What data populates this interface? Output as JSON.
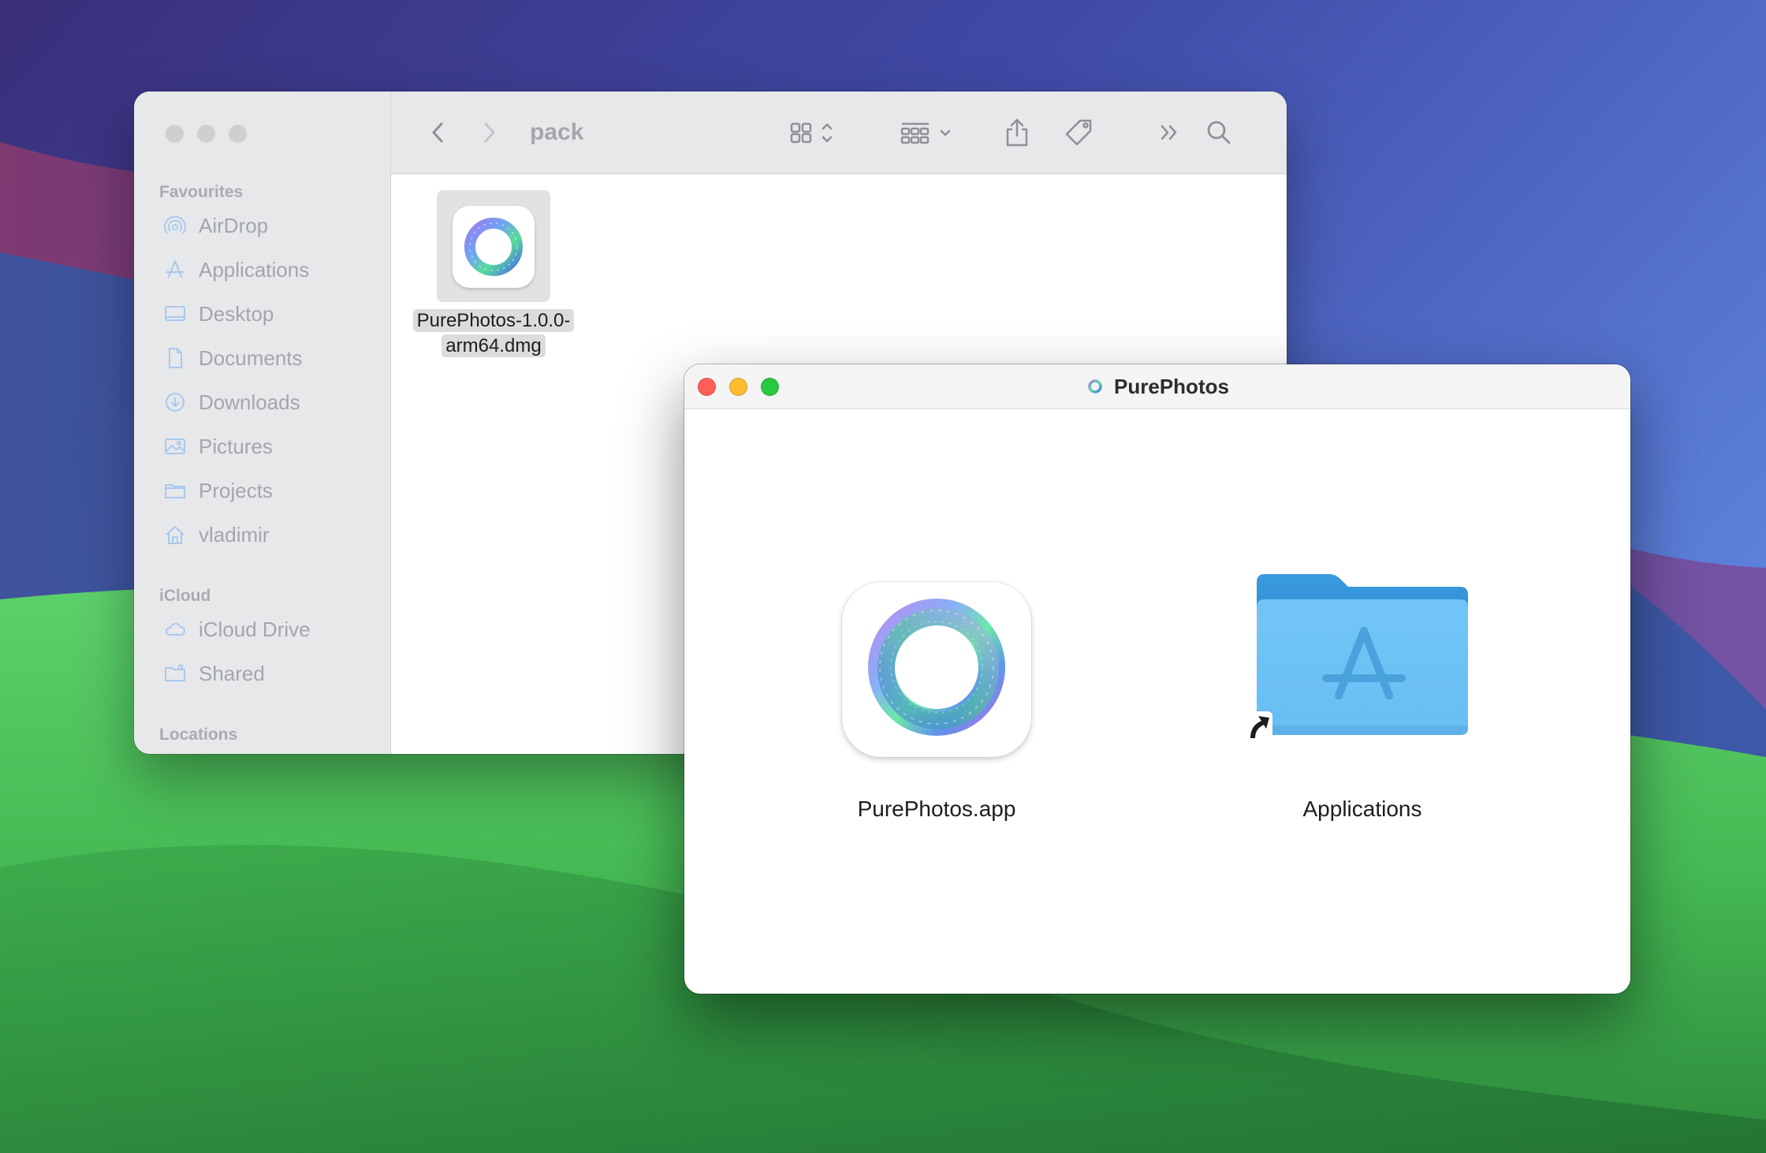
{
  "colors": {
    "traffic_red": "#fe5f57",
    "traffic_yellow": "#febc2e",
    "traffic_green": "#28c840",
    "folder_blue": "#6fc3f5"
  },
  "finder": {
    "title": "pack",
    "sidebar": {
      "favourites_heading": "Favourites",
      "favourites": [
        {
          "label": "AirDrop",
          "icon": "airdrop-icon"
        },
        {
          "label": "Applications",
          "icon": "applications-icon"
        },
        {
          "label": "Desktop",
          "icon": "desktop-icon"
        },
        {
          "label": "Documents",
          "icon": "document-icon"
        },
        {
          "label": "Downloads",
          "icon": "downloads-icon"
        },
        {
          "label": "Pictures",
          "icon": "pictures-icon"
        },
        {
          "label": "Projects",
          "icon": "folder-icon"
        },
        {
          "label": "vladimir",
          "icon": "home-icon"
        }
      ],
      "icloud_heading": "iCloud",
      "icloud": [
        {
          "label": "iCloud Drive",
          "icon": "cloud-icon"
        },
        {
          "label": "Shared",
          "icon": "shared-folder-icon"
        }
      ],
      "locations_heading": "Locations"
    },
    "file": {
      "name_line1": "PurePhotos-1.0.0-",
      "name_line2": "arm64.dmg"
    }
  },
  "dmg_window": {
    "title": "PurePhotos",
    "app_label": "PurePhotos.app",
    "applications_label": "Applications"
  }
}
